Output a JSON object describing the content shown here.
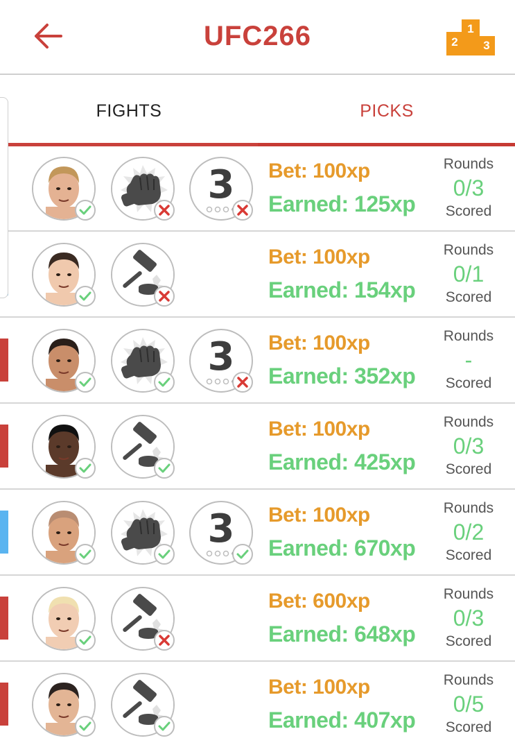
{
  "header": {
    "title": "UFC266",
    "podium_labels": [
      "1",
      "2",
      "3"
    ],
    "accent": "#c9413b",
    "podium_color": "#f39a1a"
  },
  "tabs": [
    {
      "label": "FIGHTS",
      "active": false
    },
    {
      "label": "PICKS",
      "active": true
    }
  ],
  "labels": {
    "rounds": "Rounds",
    "scored": "Scored",
    "round_pick_number": "3"
  },
  "picks": [
    {
      "fighter_icon": "fighter-avatar",
      "fighter_result": "correct",
      "method_icon": "fist-icon",
      "method_result": "wrong",
      "round_pick": true,
      "round_result": "wrong",
      "bet": "Bet: 100xp",
      "earned": "Earned: 125xp",
      "rounds_scored": "0/3",
      "side_color": "#e8b0ad"
    },
    {
      "fighter_icon": "fighter-avatar",
      "fighter_result": "correct",
      "method_icon": "gavel-icon",
      "method_result": "wrong",
      "round_pick": false,
      "bet": "Bet: 100xp",
      "earned": "Earned: 154xp",
      "rounds_scored": "0/1",
      "side_color": "#9fd3f0"
    },
    {
      "fighter_icon": "fighter-avatar",
      "fighter_result": "correct",
      "method_icon": "fist-icon",
      "method_result": "correct",
      "round_pick": true,
      "round_result": "wrong",
      "bet": "Bet: 100xp",
      "earned": "Earned: 352xp",
      "rounds_scored": "-",
      "side_color": "#c9413b"
    },
    {
      "fighter_icon": "fighter-avatar",
      "fighter_result": "correct",
      "method_icon": "gavel-icon",
      "method_result": "correct",
      "round_pick": false,
      "bet": "Bet: 100xp",
      "earned": "Earned: 425xp",
      "rounds_scored": "0/3",
      "side_color": "#c9413b"
    },
    {
      "fighter_icon": "fighter-avatar",
      "fighter_result": "correct",
      "method_icon": "fist-icon",
      "method_result": "correct",
      "round_pick": true,
      "round_result": "correct",
      "bet": "Bet: 100xp",
      "earned": "Earned: 670xp",
      "rounds_scored": "0/2",
      "side_color": "#5ab4f0"
    },
    {
      "fighter_icon": "fighter-avatar",
      "fighter_result": "correct",
      "method_icon": "gavel-icon",
      "method_result": "wrong",
      "round_pick": false,
      "bet": "Bet: 600xp",
      "earned": "Earned: 648xp",
      "rounds_scored": "0/3",
      "side_color": "#c9413b"
    },
    {
      "fighter_icon": "fighter-avatar",
      "fighter_result": "correct",
      "method_icon": "gavel-icon",
      "method_result": "correct",
      "round_pick": false,
      "bet": "Bet: 100xp",
      "earned": "Earned: 407xp",
      "rounds_scored": "0/5",
      "side_color": "#c9413b"
    }
  ],
  "colors": {
    "bet": "#e69a2b",
    "earned": "#69d07c",
    "correct": "#69d07c",
    "wrong": "#d93a35"
  }
}
